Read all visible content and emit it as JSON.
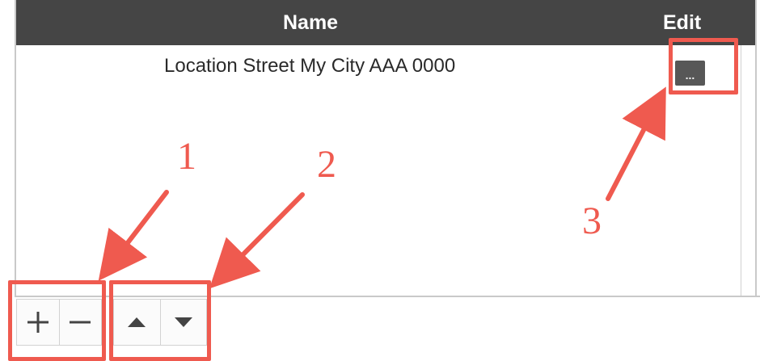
{
  "table": {
    "headers": {
      "name": "Name",
      "edit": "Edit"
    },
    "rows": [
      {
        "name": "Location Street My City AAA 0000",
        "edit_label": "..."
      }
    ]
  },
  "toolbar": {
    "add_icon": "plus-icon",
    "remove_icon": "minus-icon",
    "move_up_icon": "triangle-up-icon",
    "move_down_icon": "triangle-down-icon"
  },
  "annotations": {
    "labels": [
      "1",
      "2",
      "3"
    ],
    "color": "#ef5a4f"
  },
  "colors": {
    "header_background": "#454545",
    "header_text": "#ffffff",
    "edit_button": "#575757"
  }
}
